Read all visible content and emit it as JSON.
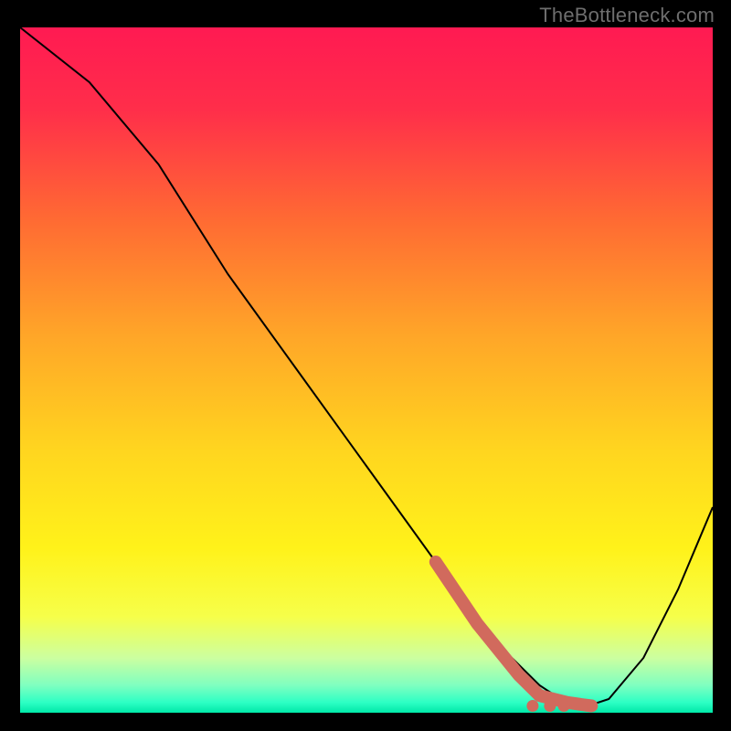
{
  "watermark": "TheBottleneck.com",
  "chart_data": {
    "type": "line",
    "title": "",
    "xlabel": "",
    "ylabel": "",
    "xlim": [
      0,
      100
    ],
    "ylim": [
      0,
      100
    ],
    "grid": false,
    "legend": false,
    "series": [
      {
        "name": "main-curve",
        "color": "#000000",
        "x": [
          0,
          10,
          20,
          30,
          40,
          50,
          60,
          65,
          70,
          75,
          78,
          80,
          82,
          85,
          90,
          95,
          100
        ],
        "y": [
          100,
          92,
          80,
          64,
          50,
          36,
          22,
          15,
          9,
          4,
          2,
          1,
          1,
          2,
          8,
          18,
          30
        ]
      },
      {
        "name": "highlight-segment",
        "color": "#d16a5d",
        "x": [
          60,
          63,
          66,
          68,
          70,
          72,
          73.5,
          75,
          77,
          79,
          81,
          82.5
        ],
        "y": [
          22,
          17.5,
          13,
          10.5,
          8,
          5.5,
          4,
          2.5,
          2,
          1.5,
          1.2,
          1
        ]
      },
      {
        "name": "highlight-dots",
        "color": "#d16a5d",
        "points": [
          {
            "x": 74,
            "y": 1
          },
          {
            "x": 76.5,
            "y": 1
          },
          {
            "x": 78.5,
            "y": 1
          },
          {
            "x": 82.5,
            "y": 1
          }
        ]
      }
    ],
    "background_gradient_stops": [
      {
        "offset": 0.0,
        "color": "#ff1a52"
      },
      {
        "offset": 0.12,
        "color": "#ff2e4a"
      },
      {
        "offset": 0.28,
        "color": "#ff6a33"
      },
      {
        "offset": 0.45,
        "color": "#ffa628"
      },
      {
        "offset": 0.62,
        "color": "#ffd61f"
      },
      {
        "offset": 0.76,
        "color": "#fff21a"
      },
      {
        "offset": 0.86,
        "color": "#f6ff4a"
      },
      {
        "offset": 0.92,
        "color": "#ccffa0"
      },
      {
        "offset": 0.96,
        "color": "#7fffc0"
      },
      {
        "offset": 0.985,
        "color": "#2dffc4"
      },
      {
        "offset": 1.0,
        "color": "#00e8a8"
      }
    ]
  }
}
